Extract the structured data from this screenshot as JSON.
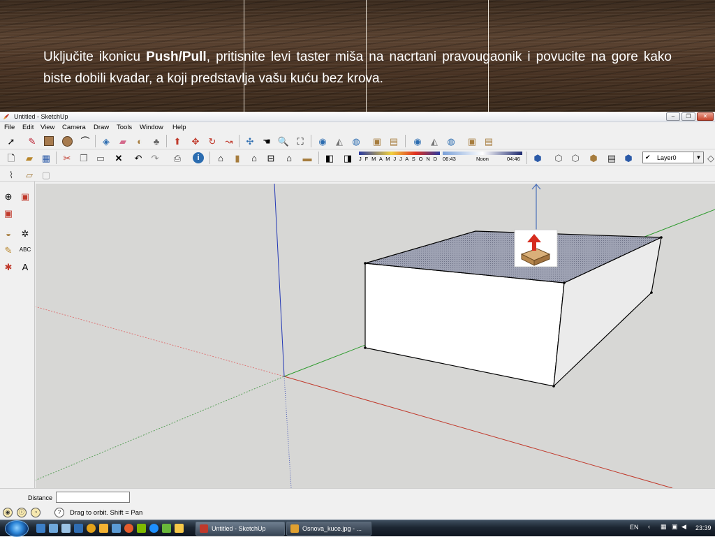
{
  "slide": {
    "text_before_bold": "Uključite ikonicu ",
    "bold": "Push/Pull",
    "text_after_bold": ", pritisnite levi taster miša na nacrtani pravougaonik i povucite na gore kako biste dobili kvadar, a koji predstavlja vašu kuću bez krova."
  },
  "window": {
    "title": "Untitled - SketchUp",
    "menus": [
      "File",
      "Edit",
      "View",
      "Camera",
      "Draw",
      "Tools",
      "Window",
      "Help"
    ]
  },
  "shadow_bar": {
    "months": "J F M A M J J A S O N D",
    "time_start": "06:43",
    "time_mid": "Noon",
    "time_end": "04:46"
  },
  "layer": {
    "name": "Layer0"
  },
  "status": {
    "distance_label": "Distance",
    "distance_value": "",
    "message": "Drag to orbit.  Shift = Pan"
  },
  "taskbar": {
    "tasks": [
      "Untitled - SketchUp",
      "Osnova_kuce.jpg - ..."
    ],
    "lang": "EN",
    "clock": "23:39"
  },
  "colors": {
    "viewport_bg": "#d7d7d5",
    "axis_red": "#c0392b",
    "axis_green": "#2e9b2e",
    "axis_blue": "#2338b5",
    "top_face": "#8f94a6"
  }
}
